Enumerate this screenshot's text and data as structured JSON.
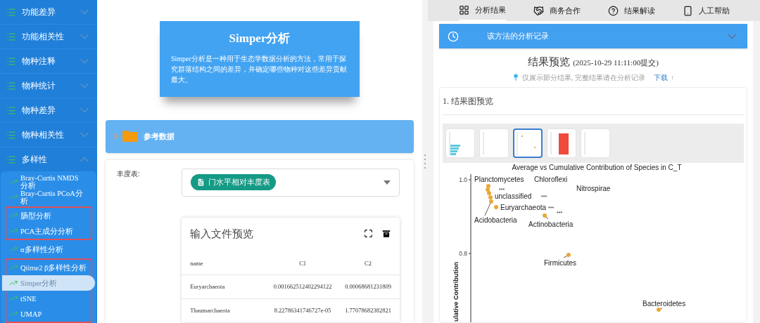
{
  "sidebar": {
    "groups": [
      {
        "label": "功能差异",
        "expanded": false
      },
      {
        "label": "功能相关性",
        "expanded": false
      },
      {
        "label": "物种注释",
        "expanded": false
      },
      {
        "label": "物种统计",
        "expanded": false
      },
      {
        "label": "物种差异",
        "expanded": false
      },
      {
        "label": "物种相关性",
        "expanded": false
      },
      {
        "label": "多样性",
        "expanded": true,
        "sections": [
          {
            "outlined": false,
            "items": [
              {
                "label": "Bray-Curtis NMDS 分析",
                "selected": false
              },
              {
                "label": "Bray-Curtis PCoA分析",
                "selected": false
              }
            ]
          },
          {
            "outlined": true,
            "items": [
              {
                "label": "肠型分析",
                "selected": false
              },
              {
                "label": "PCA主成分分析",
                "selected": false
              }
            ]
          },
          {
            "outlined": false,
            "items": [
              {
                "label": "α多样性分析",
                "selected": false
              }
            ]
          },
          {
            "outlined": true,
            "items": [
              {
                "label": "Qiime2 β多样性分析",
                "selected": false
              },
              {
                "label": "Simper分析",
                "selected": true
              },
              {
                "label": "tSNE",
                "selected": false
              },
              {
                "label": "UMAP",
                "selected": false
              }
            ]
          }
        ]
      }
    ]
  },
  "intro": {
    "title": "Simper分析",
    "description": "Simper分析是一种用于生态学数据分析的方法，常用于探究群落结构之间的差异，并确定哪些物种对这些差异贡献最大。"
  },
  "reference_section": {
    "title": "参考数据",
    "expanded": false
  },
  "form": {
    "label": "丰度表:",
    "selected_file": "门水平相对丰度表"
  },
  "preview": {
    "title": "输入文件预览",
    "columns": [
      "name",
      "C1",
      "C2"
    ],
    "rows": [
      [
        "Euryarchaeota",
        "0.001662512402294122",
        "0.00068681231809"
      ],
      [
        "Thaumarchaeota",
        "8.22786341746727e-05",
        "1.77078682382821"
      ]
    ]
  },
  "tabs": [
    {
      "label": "分析结果",
      "selected": true
    },
    {
      "label": "商务合作",
      "selected": false
    },
    {
      "label": "结果解读",
      "selected": false
    },
    {
      "label": "人工帮助",
      "selected": false
    }
  ],
  "history_bar": {
    "label": "该方法的分析记录",
    "expanded": false
  },
  "result": {
    "title": "结果预览",
    "submitted": "(2025-10-29 11:11:00提交)",
    "note": "仅展示部分结果, 完整结果请在分析记录",
    "link": "下载",
    "arrow": "↑"
  },
  "figures": {
    "title": "1. 结果图预览",
    "thumbnails": [
      {
        "kind": "bars",
        "selected": false
      },
      {
        "kind": "blank",
        "selected": false
      },
      {
        "kind": "scatter",
        "selected": true
      },
      {
        "kind": "heatmap",
        "selected": false
      },
      {
        "kind": "blank",
        "selected": false
      }
    ],
    "plot": {
      "title": "Average vs Cumulative Contribution of Species in C_T",
      "y_axis_label": "ulative Contribution",
      "y_tick_labels": [
        "1.0",
        "0.8"
      ],
      "point_labels": [
        "Planctomycetes",
        "Chloroflexi",
        "Nitrospirae",
        "unclassified",
        "Euryarchaeota",
        "Acidobacteria",
        "Actinobacteria",
        "Firmicutes",
        "Bacteroidetes"
      ],
      "significance_marks": [
        "***",
        "***",
        "***",
        "***"
      ]
    }
  }
}
